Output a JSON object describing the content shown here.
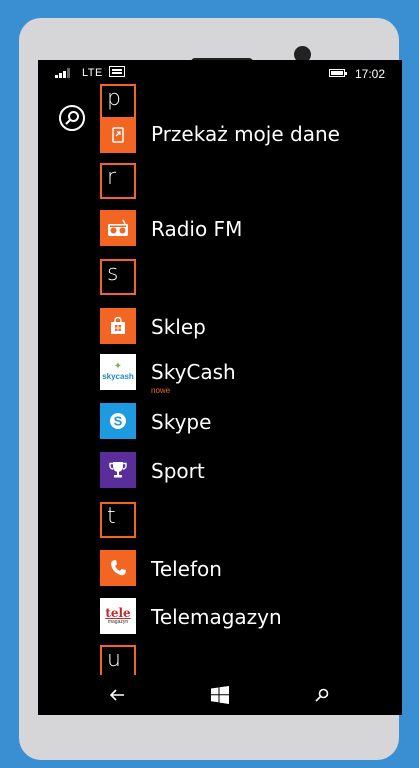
{
  "status": {
    "network": "LTE",
    "time": "17:02"
  },
  "list": {
    "header_p": "p",
    "app_przekaz": "Przekaż moje dane",
    "header_r": "r",
    "app_radio": "Radio FM",
    "header_s": "s",
    "app_sklep": "Sklep",
    "app_skycash": "SkyCash",
    "app_skycash_badge": "nowe",
    "skycash_logo_text": "skycash",
    "app_skype": "Skype",
    "app_sport": "Sport",
    "header_t": "t",
    "app_telefon": "Telefon",
    "app_telemagazyn": "Telemagazyn",
    "telemagazyn_logo_text": "tele",
    "telemagazyn_logo_sub": "magazyn",
    "header_u": "u"
  },
  "colors": {
    "accent": "#f26522",
    "skype": "#1e9be0",
    "sport": "#5a2d9a",
    "background": "#3a8fd2"
  },
  "icons": [
    "search-icon",
    "back-arrow-icon",
    "windows-start-icon",
    "search-icon"
  ]
}
